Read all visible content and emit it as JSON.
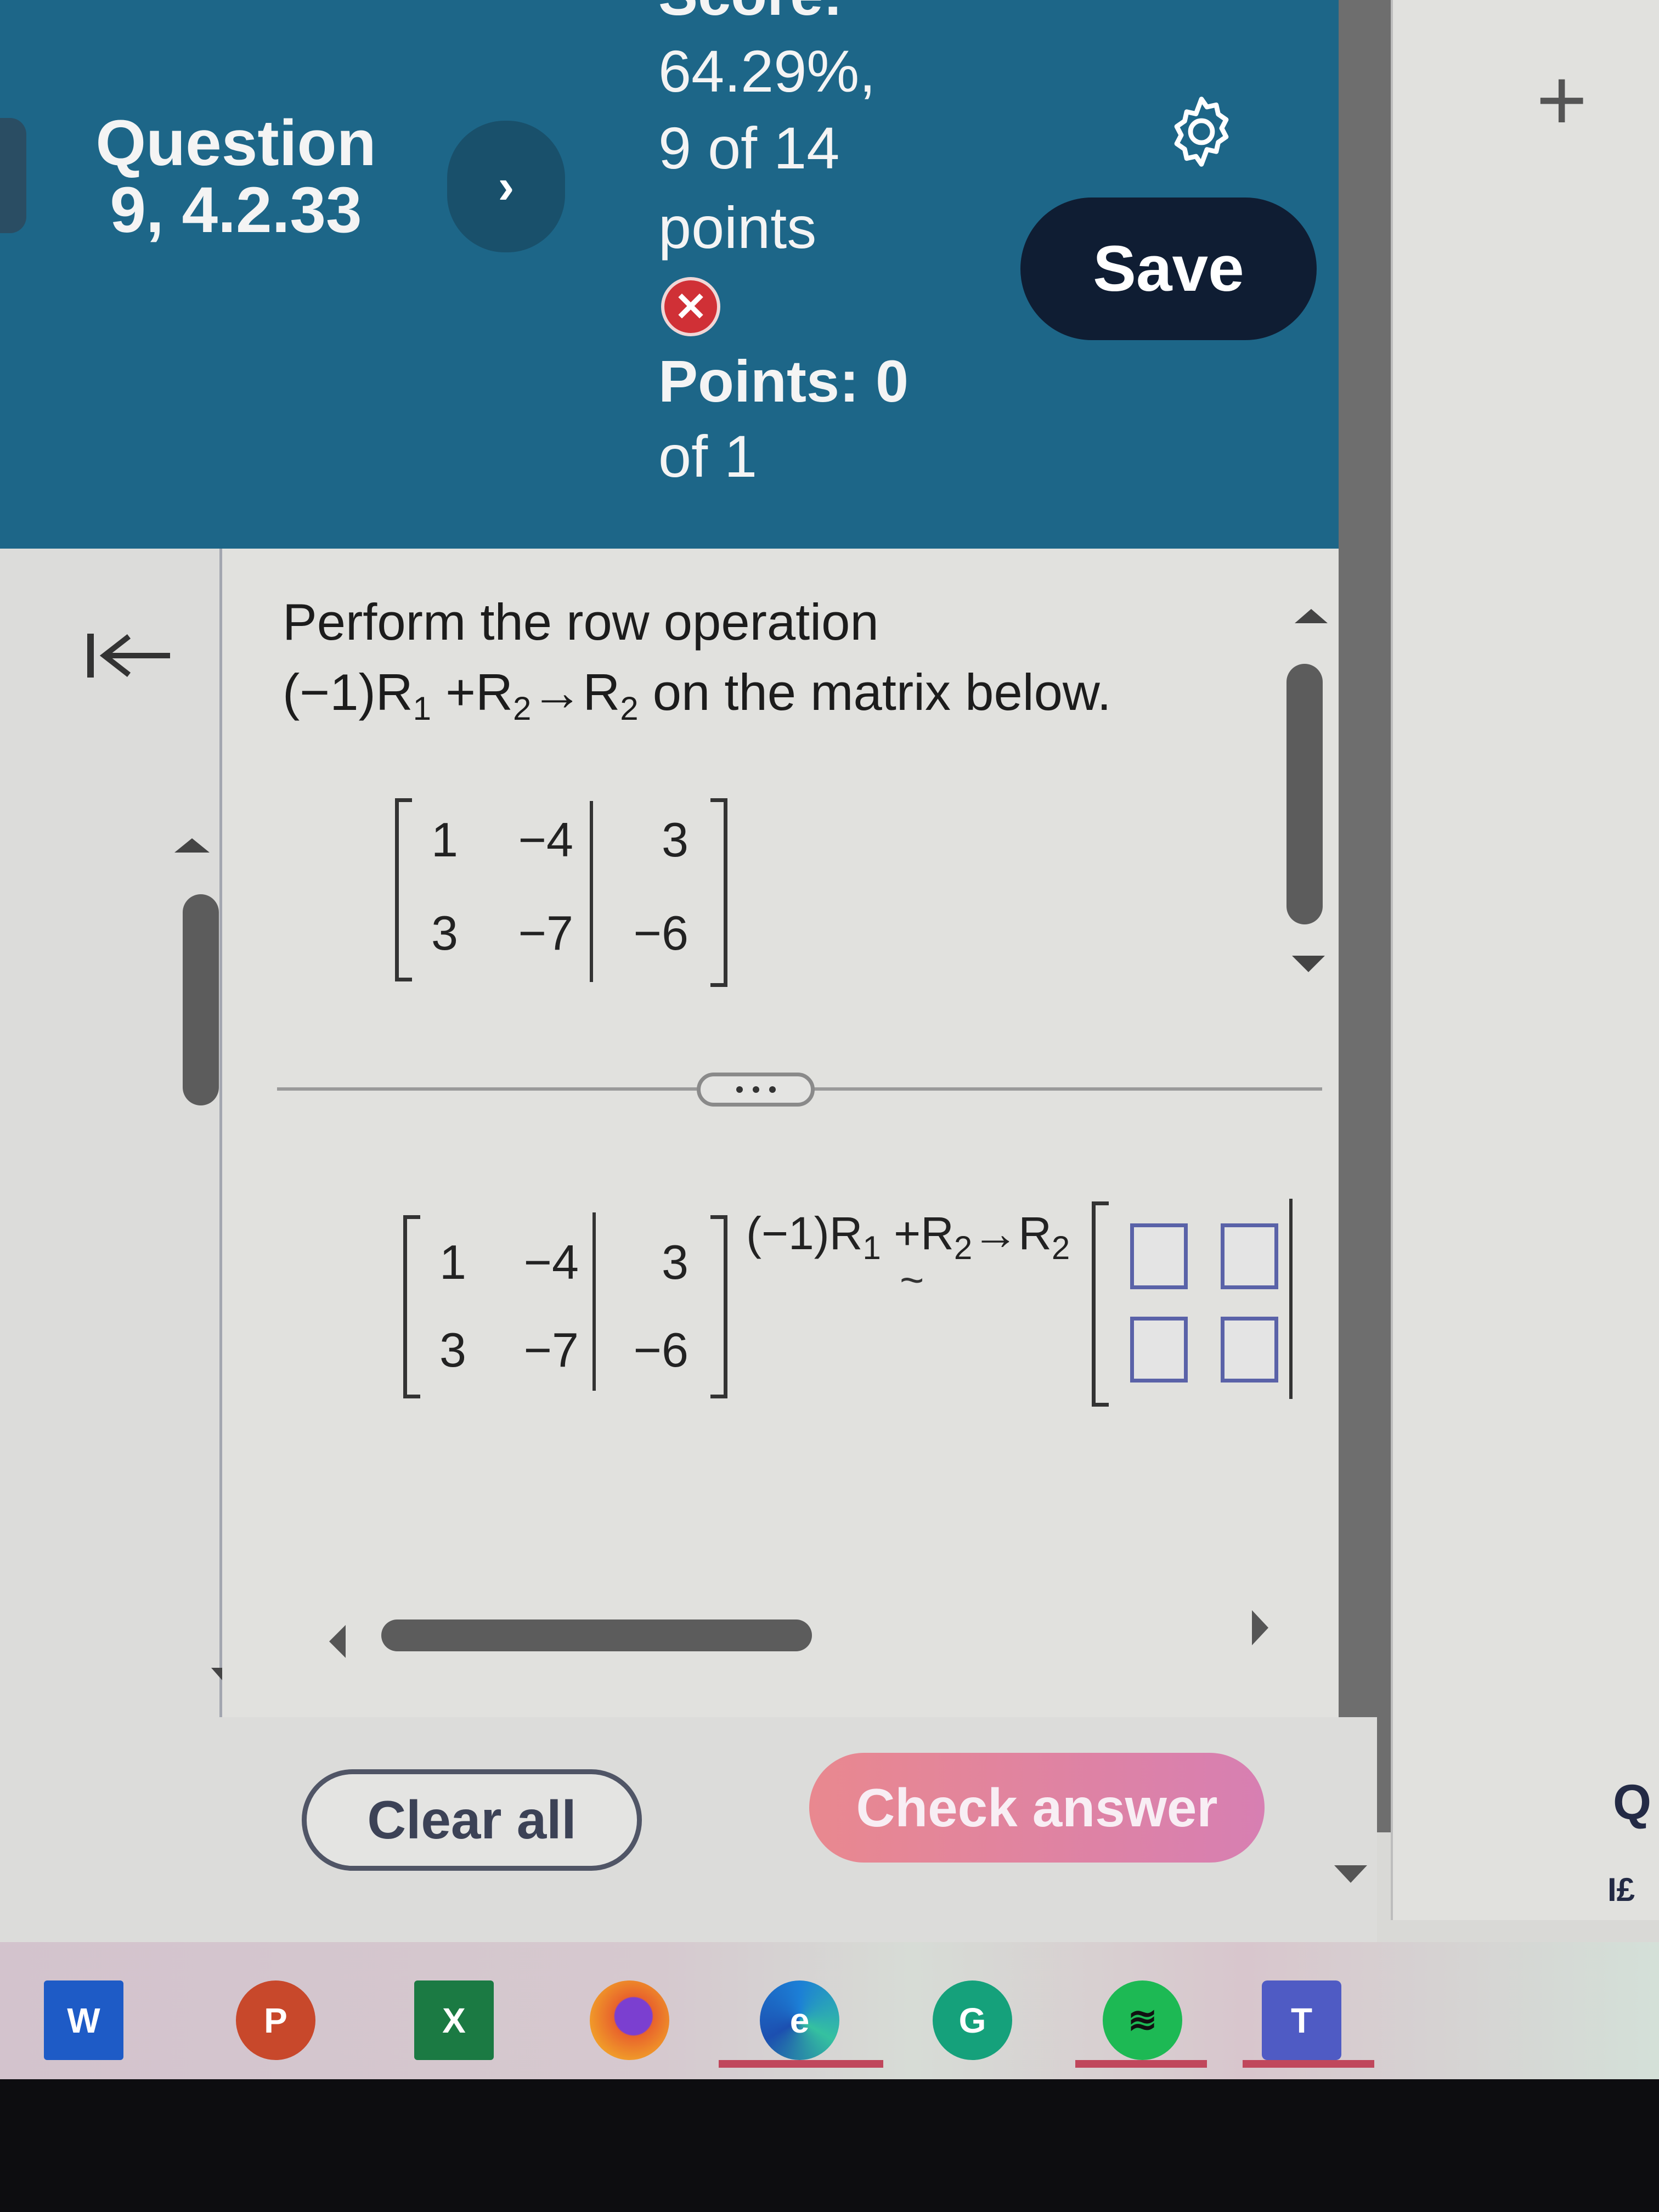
{
  "header": {
    "question_title": "Question 9, 4.2.33",
    "next_label": "›",
    "score_label": "Score:",
    "score_percent": "64.29%,",
    "score_points": "9 of 14",
    "score_points_word": "points",
    "status_icon": "x-circle-icon",
    "points_line": "Points: 0",
    "points_of": "of 1",
    "save_label": "Save",
    "settings_icon": "gear-icon",
    "accent_color": "#1d6688",
    "save_color": "#0f1d33",
    "status_color": "#d03036"
  },
  "question": {
    "line1": "Perform the row operation",
    "op_prefix": "(−1)R",
    "op_sub1": "1",
    "op_plus": " +R",
    "op_sub2": "2",
    "op_arrow": "→R",
    "op_sub3": "2",
    "line2_suffix": " on the matrix below."
  },
  "matrix": {
    "rows": [
      [
        "1",
        "−4",
        "3"
      ],
      [
        "3",
        "−7",
        "−6"
      ]
    ]
  },
  "answer": {
    "given_rows": [
      [
        "1",
        "−4",
        "3"
      ],
      [
        "3",
        "−7",
        "−6"
      ]
    ],
    "operation_prefix": "(−1)R",
    "operation_sub1": "1",
    "operation_plus": " +R",
    "operation_sub2": "2",
    "operation_arrow": "→R",
    "operation_sub3": "2",
    "tilde": "~",
    "input_values": [
      "",
      "",
      "",
      ""
    ]
  },
  "divider": {
    "label": "•••"
  },
  "footer": {
    "clear_label": "Clear all",
    "check_label": "Check answer",
    "check_color": "#e08aa0"
  },
  "right_panel": {
    "plus_label": "+",
    "partial_text_1": "Q",
    "partial_text_2": "I£"
  },
  "taskbar": {
    "apps": [
      {
        "name": "word",
        "label": "W",
        "color": "#1e5bc6"
      },
      {
        "name": "powerpoint",
        "label": "P",
        "color": "#c8482b"
      },
      {
        "name": "excel",
        "label": "X",
        "color": "#1b7a43"
      },
      {
        "name": "firefox",
        "label": "",
        "color": "#e8632b"
      },
      {
        "name": "edge",
        "label": "e",
        "color": "#1c7fd6"
      },
      {
        "name": "grammarly",
        "label": "G",
        "color": "#15a17b"
      },
      {
        "name": "spotify",
        "label": "≋",
        "color": "#1db954"
      },
      {
        "name": "teams",
        "label": "T",
        "color": "#4f5bc4"
      }
    ]
  }
}
